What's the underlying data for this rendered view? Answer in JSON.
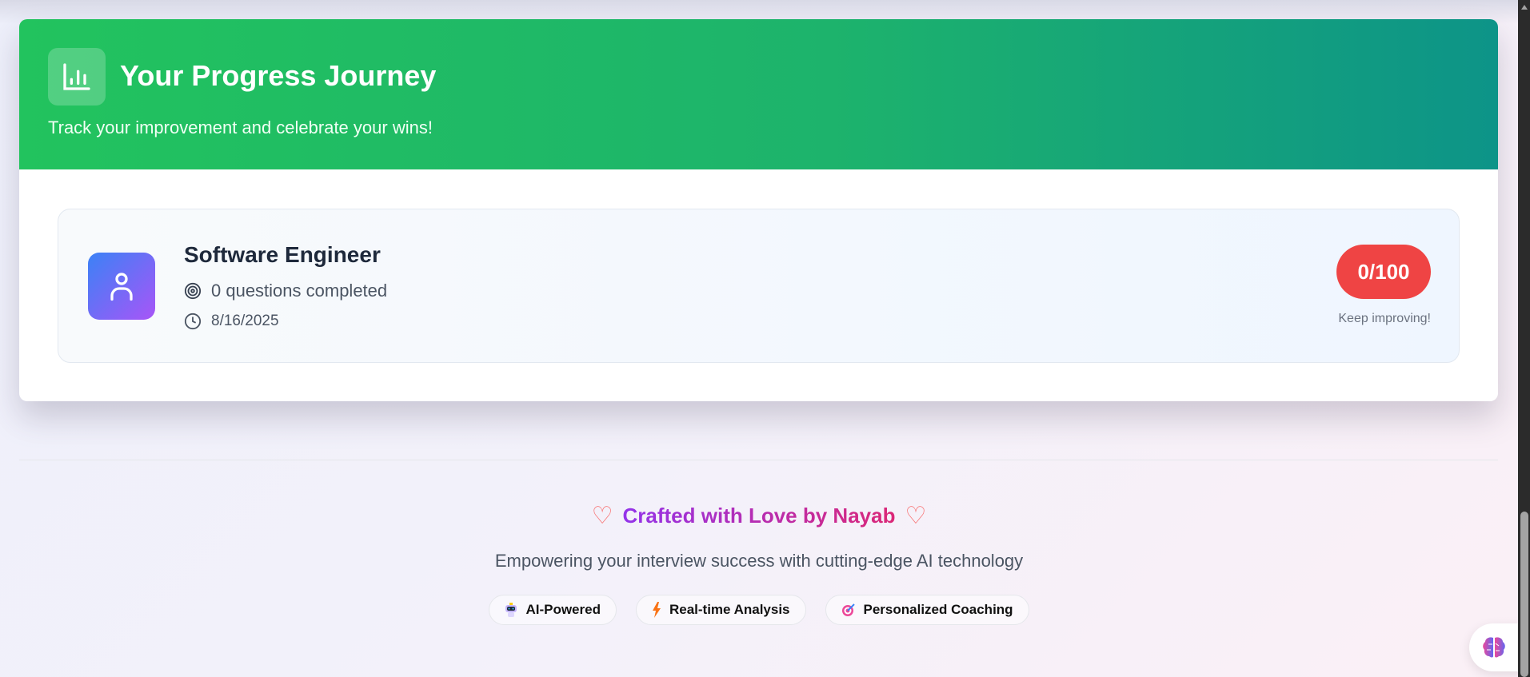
{
  "progress": {
    "title": "Your Progress Journey",
    "subtitle": "Track your improvement and celebrate your wins!",
    "session": {
      "role": "Software Engineer",
      "questions": "0 questions completed",
      "date": "8/16/2025",
      "score": "0/100",
      "score_progress": 0,
      "feedback": "Keep improving!"
    }
  },
  "footer": {
    "credit": "Crafted with Love by Nayab",
    "tagline": "Empowering your interview success with cutting-edge AI technology",
    "chips": [
      {
        "label": "AI-Powered",
        "icon": "robot-icon"
      },
      {
        "label": "Real-time Analysis",
        "icon": "lightning-icon"
      },
      {
        "label": "Personalized Coaching",
        "icon": "target-icon"
      }
    ]
  },
  "colors": {
    "header_start": "#22c35e",
    "header_end": "#0d9488",
    "score_bg": "#ef4444",
    "accent_purple": "#9333ea",
    "accent_pink": "#db2777"
  }
}
